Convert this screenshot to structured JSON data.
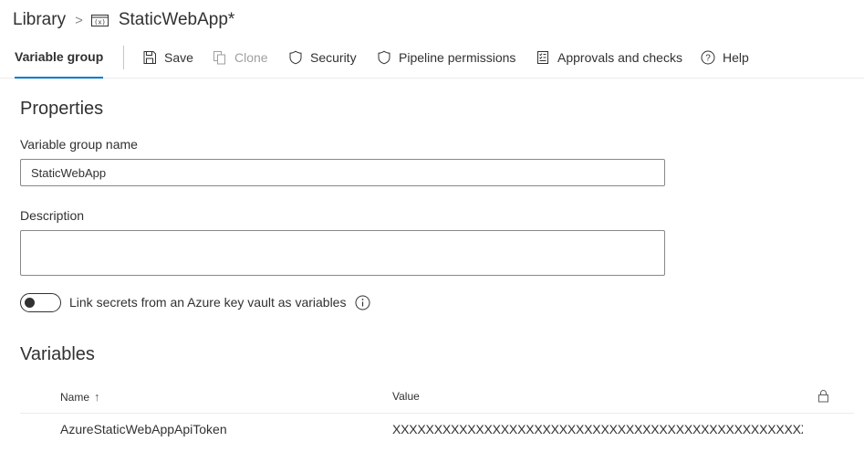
{
  "breadcrumb": {
    "library": "Library",
    "separator": ">",
    "current": "StaticWebApp*",
    "current_icon": "variable-group-icon"
  },
  "toolbar": {
    "active_tab": "Variable group",
    "save": "Save",
    "clone": "Clone",
    "security": "Security",
    "pipeline_permissions": "Pipeline permissions",
    "approvals_and_checks": "Approvals and checks",
    "help": "Help"
  },
  "properties": {
    "heading": "Properties",
    "name_label": "Variable group name",
    "name_value": "StaticWebApp",
    "description_label": "Description",
    "description_value": "",
    "keyvault_toggle_label": "Link secrets from an Azure key vault as variables",
    "keyvault_toggle_on": false
  },
  "variables": {
    "heading": "Variables",
    "columns": {
      "name": "Name",
      "name_sort": "↑",
      "value": "Value"
    },
    "rows": [
      {
        "name": "AzureStaticWebAppApiToken",
        "value": "XXXXXXXXXXXXXXXXXXXXXXXXXXXXXXXXXXXXXXXXXXXXXXXXXX..."
      }
    ]
  },
  "colors": {
    "accent": "#0078d4",
    "text": "#323130",
    "disabled": "#a19f9d",
    "border": "#8a8886"
  }
}
